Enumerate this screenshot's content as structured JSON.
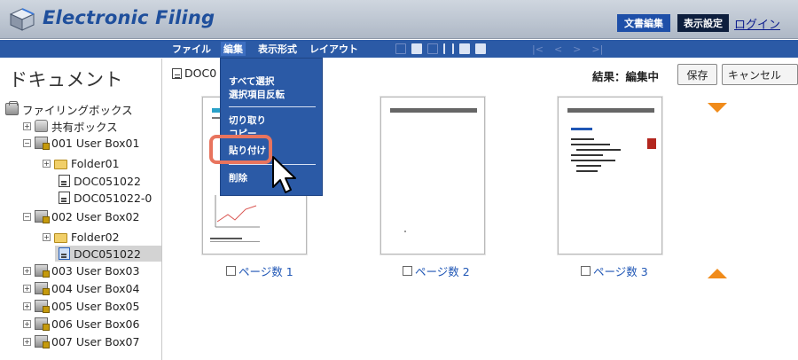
{
  "header": {
    "app_title": "Electronic Filing",
    "buttons": [
      "文書編集",
      "表示設定"
    ],
    "login_link": "ログイン"
  },
  "menubar": {
    "items": [
      "ファイル",
      "編集",
      "表示形式",
      "レイアウト"
    ],
    "active_index": 1,
    "nav_glyphs": [
      "|<",
      "<",
      ">",
      ">|"
    ]
  },
  "sidebar": {
    "heading": "ドキュメント",
    "tree": [
      {
        "label": "ファイリングボックス",
        "icon": "filing-box-icon",
        "expander": ""
      },
      {
        "label": "共有ボックス",
        "icon": "shared-box-icon",
        "expander": "+"
      },
      {
        "label": "001 User Box01",
        "icon": "locked-box-icon",
        "expander": "−"
      },
      {
        "label": "Folder01",
        "icon": "folder-icon",
        "expander": "+"
      },
      {
        "label": "DOC051022",
        "icon": "document-icon",
        "expander": ""
      },
      {
        "label": "DOC051022-0",
        "icon": "document-icon",
        "expander": ""
      },
      {
        "label": "002 User Box02",
        "icon": "locked-box-icon",
        "expander": "−"
      },
      {
        "label": "Folder02",
        "icon": "folder-icon",
        "expander": "+"
      },
      {
        "label": "DOC051022",
        "icon": "document-icon",
        "expander": "",
        "selected": true
      },
      {
        "label": "003 User Box03",
        "icon": "locked-box-icon",
        "expander": "+"
      },
      {
        "label": "004 User Box04",
        "icon": "locked-box-icon",
        "expander": "+"
      },
      {
        "label": "005 User Box05",
        "icon": "locked-box-icon",
        "expander": "+"
      },
      {
        "label": "006 User Box06",
        "icon": "locked-box-icon",
        "expander": "+"
      },
      {
        "label": "007 User Box07",
        "icon": "locked-box-icon",
        "expander": "+"
      }
    ]
  },
  "content": {
    "path_label": "DOC0",
    "result_label": "結果：編集中",
    "save_button": "保存",
    "cancel_button": "キャンセル",
    "pages": [
      {
        "caption": "ページ数 1",
        "checked": false
      },
      {
        "caption": "ページ数 2",
        "checked": false
      },
      {
        "caption": "ページ数 3",
        "checked": false
      }
    ]
  },
  "edit_menu": {
    "items": [
      "すべて選択",
      "選択項目反転",
      "切り取り",
      "コピー",
      "貼り付け",
      "削除"
    ],
    "highlighted_item": "貼り付け"
  },
  "colors": {
    "menubar": "#2b5aa6",
    "title": "#1f4f9c",
    "highlight_ring": "#e8745e",
    "scroll_arrows": "#f08b1a",
    "page_link": "#1f56b5"
  }
}
